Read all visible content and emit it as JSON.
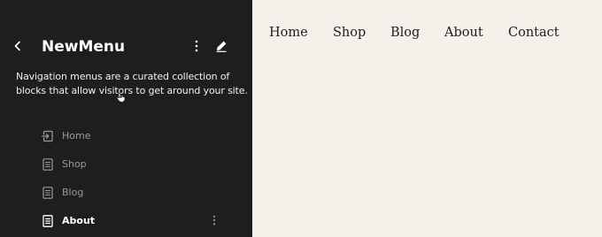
{
  "sidebar": {
    "title": "NewMenu",
    "description": "Navigation menus are a curated collection of blocks that allow visitors to get around your site.",
    "back_icon": "chevron-left-icon",
    "options_icon": "kebab-vertical-icon",
    "edit_icon": "pencil-icon",
    "items": [
      {
        "label": "Home",
        "icon": "home-link-icon"
      },
      {
        "label": "Shop",
        "icon": "page-icon"
      },
      {
        "label": "Blog",
        "icon": "page-icon"
      },
      {
        "label": "About",
        "icon": "page-icon",
        "active": true
      }
    ]
  },
  "preview": {
    "links": [
      "Home",
      "Shop",
      "Blog",
      "About",
      "Contact"
    ]
  },
  "colors": {
    "sidebar_bg": "#1e1e1e",
    "canvas_bg": "#f4f1ea",
    "inactive_item": "#9b9b9b",
    "active_item": "#ffffff"
  }
}
